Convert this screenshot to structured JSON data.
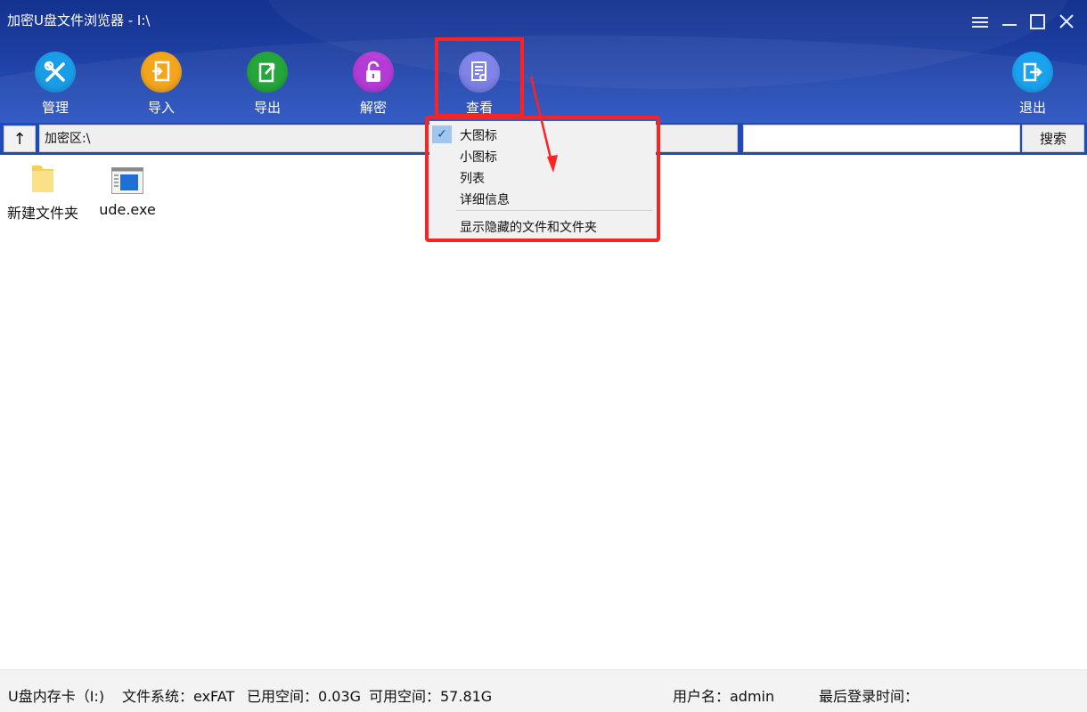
{
  "window": {
    "title": "加密U盘文件浏览器 - I:\\"
  },
  "toolbar": {
    "manage": "管理",
    "import": "导入",
    "export": "导出",
    "decrypt": "解密",
    "view": "查看",
    "exit": "退出"
  },
  "address": {
    "up": "↑",
    "path": "加密区:\\",
    "search_value": "",
    "search_button": "搜索"
  },
  "files": [
    {
      "name": "新建文件夹",
      "icon": "folder-icon"
    },
    {
      "name": "ude.exe",
      "icon": "exe-file-icon"
    }
  ],
  "menu": {
    "items": [
      {
        "label": "大图标",
        "checked": true
      },
      {
        "label": "小图标",
        "checked": false
      },
      {
        "label": "列表",
        "checked": false
      },
      {
        "label": "详细信息",
        "checked": false
      }
    ],
    "extra": "显示隐藏的文件和文件夹"
  },
  "status": {
    "drive": "U盘内存卡（I:)",
    "fs": "文件系统：exFAT",
    "used": "已用空间：0.03G",
    "free": "可用空间：57.81G",
    "user": "用户名：admin",
    "last_login": "最后登录时间："
  },
  "colors": {
    "header": "#1e3fa3",
    "highlight": "#ff2222"
  }
}
